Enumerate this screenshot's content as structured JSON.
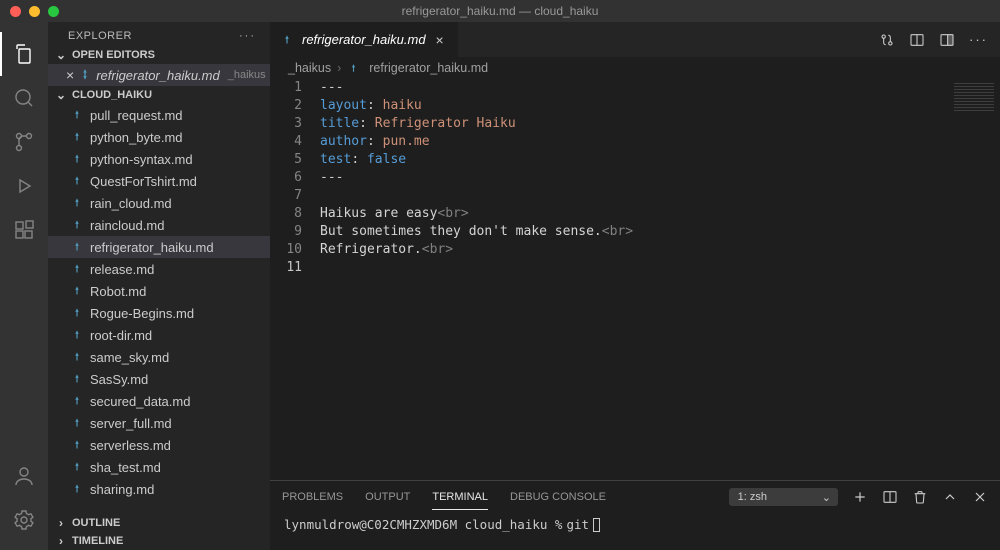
{
  "window_title": "refrigerator_haiku.md — cloud_haiku",
  "sidebar": {
    "title": "EXPLORER",
    "sections": {
      "open_editors": "OPEN EDITORS",
      "folder": "CLOUD_HAIKU",
      "outline": "OUTLINE",
      "timeline": "TIMELINE"
    },
    "open_editor": {
      "filename": "refrigerator_haiku.md",
      "dir": "_haikus"
    },
    "files": [
      "pull_request.md",
      "python_byte.md",
      "python-syntax.md",
      "QuestForTshirt.md",
      "rain_cloud.md",
      "raincloud.md",
      "refrigerator_haiku.md",
      "release.md",
      "Robot.md",
      "Rogue-Begins.md",
      "root-dir.md",
      "same_sky.md",
      "SasSy.md",
      "secured_data.md",
      "server_full.md",
      "serverless.md",
      "sha_test.md",
      "sharing.md"
    ],
    "selected_file": "refrigerator_haiku.md"
  },
  "tab": {
    "filename": "refrigerator_haiku.md"
  },
  "breadcrumb": {
    "folder": "_haikus",
    "file": "refrigerator_haiku.md"
  },
  "editor": {
    "lines": [
      {
        "n": 1,
        "raw": "---"
      },
      {
        "n": 2,
        "key": "layout",
        "val": "haiku"
      },
      {
        "n": 3,
        "key": "title",
        "val": "Refrigerator Haiku"
      },
      {
        "n": 4,
        "key": "author",
        "val": "pun.me"
      },
      {
        "n": 5,
        "key": "test",
        "bool": "false"
      },
      {
        "n": 6,
        "raw": "---"
      },
      {
        "n": 7,
        "raw": ""
      },
      {
        "n": 8,
        "text": "Haikus are easy",
        "br": true
      },
      {
        "n": 9,
        "text": "But sometimes they don't make sense.",
        "br": true
      },
      {
        "n": 10,
        "text": "Refrigerator.",
        "br": true
      },
      {
        "n": 11,
        "raw": ""
      }
    ],
    "active_line": 11
  },
  "panel": {
    "tabs": [
      "PROBLEMS",
      "OUTPUT",
      "TERMINAL",
      "DEBUG CONSOLE"
    ],
    "active_tab": "TERMINAL",
    "term_selector": "1: zsh",
    "prompt": "lynmuldrow@C02CMHZXMD6M cloud_haiku % ",
    "command": "git "
  }
}
